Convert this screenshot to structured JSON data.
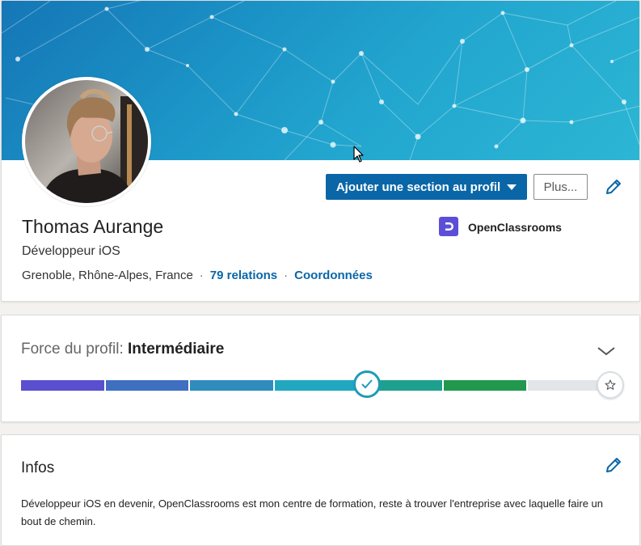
{
  "profile": {
    "name": "Thomas Aurange",
    "headline": "Développeur iOS",
    "location": "Grenoble, Rhône-Alpes, France",
    "separator": "·",
    "connections_label": "79 relations",
    "contact_label": "Coordonnées",
    "company": "OpenClassrooms"
  },
  "actions": {
    "add_section_label": "Ajouter une section au profil",
    "more_label": "Plus..."
  },
  "strength": {
    "label": "Force du profil:",
    "level": "Intermédiaire",
    "progress_steps_completed": 4,
    "progress_steps_total": 7
  },
  "about": {
    "title": "Infos",
    "text": "Développeur iOS en devenir, OpenClassrooms est mon centre de formation, reste à trouver l'entreprise avec laquelle faire un bout de chemin."
  },
  "icons": {
    "edit": "pencil-icon",
    "dropdown": "caret-down-icon",
    "collapse": "chevron-down-icon",
    "check": "check-icon",
    "star": "star-icon"
  },
  "colors": {
    "primary_button": "#0a66a7",
    "link": "#0a66a7",
    "company_logo": "#5d4ed8",
    "strength_segments": [
      "#5a4fcf",
      "#3f6fc0",
      "#2f8cbd",
      "#21a7c0",
      "#1ea08f",
      "#21984e",
      "#e2e6e9"
    ]
  }
}
